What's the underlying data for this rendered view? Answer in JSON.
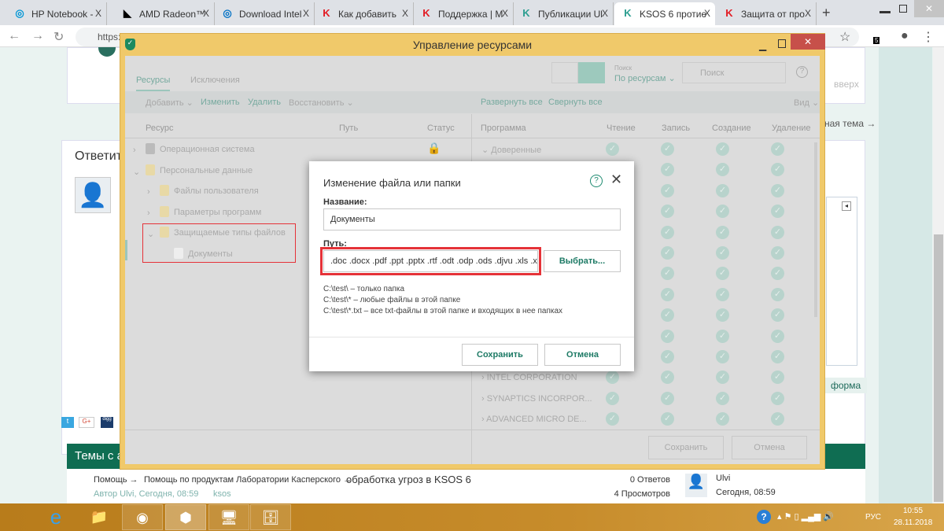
{
  "browser": {
    "tabs": [
      {
        "label": "HP Notebook -",
        "icon": "hp-icon",
        "color": "#0096d6"
      },
      {
        "label": "AMD Radeon™",
        "icon": "amd-icon",
        "color": "#000000"
      },
      {
        "label": "Download Intel",
        "icon": "intel-icon",
        "color": "#0071c5"
      },
      {
        "label": "Как добавить",
        "icon": "kaspersky-icon",
        "color": "#e21a22"
      },
      {
        "label": "Поддержка | М",
        "icon": "kaspersky-icon",
        "color": "#e21a22"
      },
      {
        "label": "Публикации Ul",
        "icon": "kaspersky-k-icon",
        "color": "#2a9d8f"
      },
      {
        "label": "KSOS 6 протие",
        "icon": "kaspersky-k-icon",
        "color": "#2a9d8f"
      },
      {
        "label": "Защита от про",
        "icon": "kaspersky-icon",
        "color": "#e21a22"
      }
    ],
    "close_tab": "X",
    "new_tab": "+",
    "url": "https://",
    "ext_badge": "5"
  },
  "page": {
    "reply_title": "Ответит",
    "go_top": "вверх",
    "next_topic": "ная тема →",
    "form_btn": "форма",
    "topics_header": "Темы с а",
    "topic": {
      "breadcrumb1": "Помощь →",
      "breadcrumb2": "Помощь по продуктам Лаборатории Касперского →",
      "title": "обработка угроз в KSOS 6",
      "meta": "Автор Ulvi, Сегодня, 08:59",
      "tag": "ksos",
      "answers": "0 Ответов",
      "views": "4 Просмотров",
      "last_user": "Ulvi",
      "last_time": "Сегодня, 08:59"
    },
    "social": [
      "t",
      "G+",
      "digg"
    ]
  },
  "kwin": {
    "title": "Управление ресурсами",
    "tabs": [
      "Ресурсы",
      "Исключения"
    ],
    "search_label": "Поиск",
    "search_by": "По ресурсам ⌄",
    "search_placeholder": "Поиск",
    "toolbar": [
      "Добавить ⌄",
      "Изменить",
      "Удалить",
      "Восстановить ⌄"
    ],
    "expand_all": "Развернуть все",
    "collapse_all": "Свернуть все",
    "view": "Вид ⌄",
    "left_cols": [
      "Ресурс",
      "Путь",
      "Статус"
    ],
    "right_cols": [
      "Программа",
      "Чтение",
      "Запись",
      "Создание",
      "Удаление"
    ],
    "tree": [
      {
        "label": "Операционная система",
        "level": 0,
        "arrow": "›"
      },
      {
        "label": "Персональные данные",
        "level": 0,
        "arrow": "⌄"
      },
      {
        "label": "Файлы пользователя",
        "level": 1,
        "arrow": "›"
      },
      {
        "label": "Параметры программ",
        "level": 1,
        "arrow": "›"
      },
      {
        "label": "Защищаемые типы файлов",
        "level": 1,
        "arrow": "⌄"
      },
      {
        "label": "Документы",
        "level": 2,
        "arrow": ""
      }
    ],
    "programs": [
      "⌄ Доверенные",
      "",
      "",
      "",
      "",
      "",
      "",
      "",
      "",
      "",
      "",
      "› INTEL CORPORATION",
      "› SYNAPTICS INCORPOR...",
      "› ADVANCED MICRO DE..."
    ],
    "save": "Сохранить",
    "cancel": "Отмена"
  },
  "dialog": {
    "title": "Изменение файла или папки",
    "name_label": "Название:",
    "name_value": "Документы",
    "path_label": "Путь:",
    "path_value": ".doc .docx .pdf .ppt .pptx .rtf .odt .odp .ods .djvu .xls .xls:",
    "browse": "Выбрать...",
    "hints": [
      "C:\\test\\ – только папка",
      "C:\\test\\* – любые файлы в этой папке",
      "C:\\test\\*.txt – все txt-файлы в этой папке и входящих в нее папках"
    ],
    "save": "Сохранить",
    "cancel": "Отмена",
    "accent": "#1d7a65",
    "highlight": "#e53238"
  },
  "taskbar": {
    "lang": "РУС",
    "time": "10:55",
    "date": "28.11.2018"
  }
}
